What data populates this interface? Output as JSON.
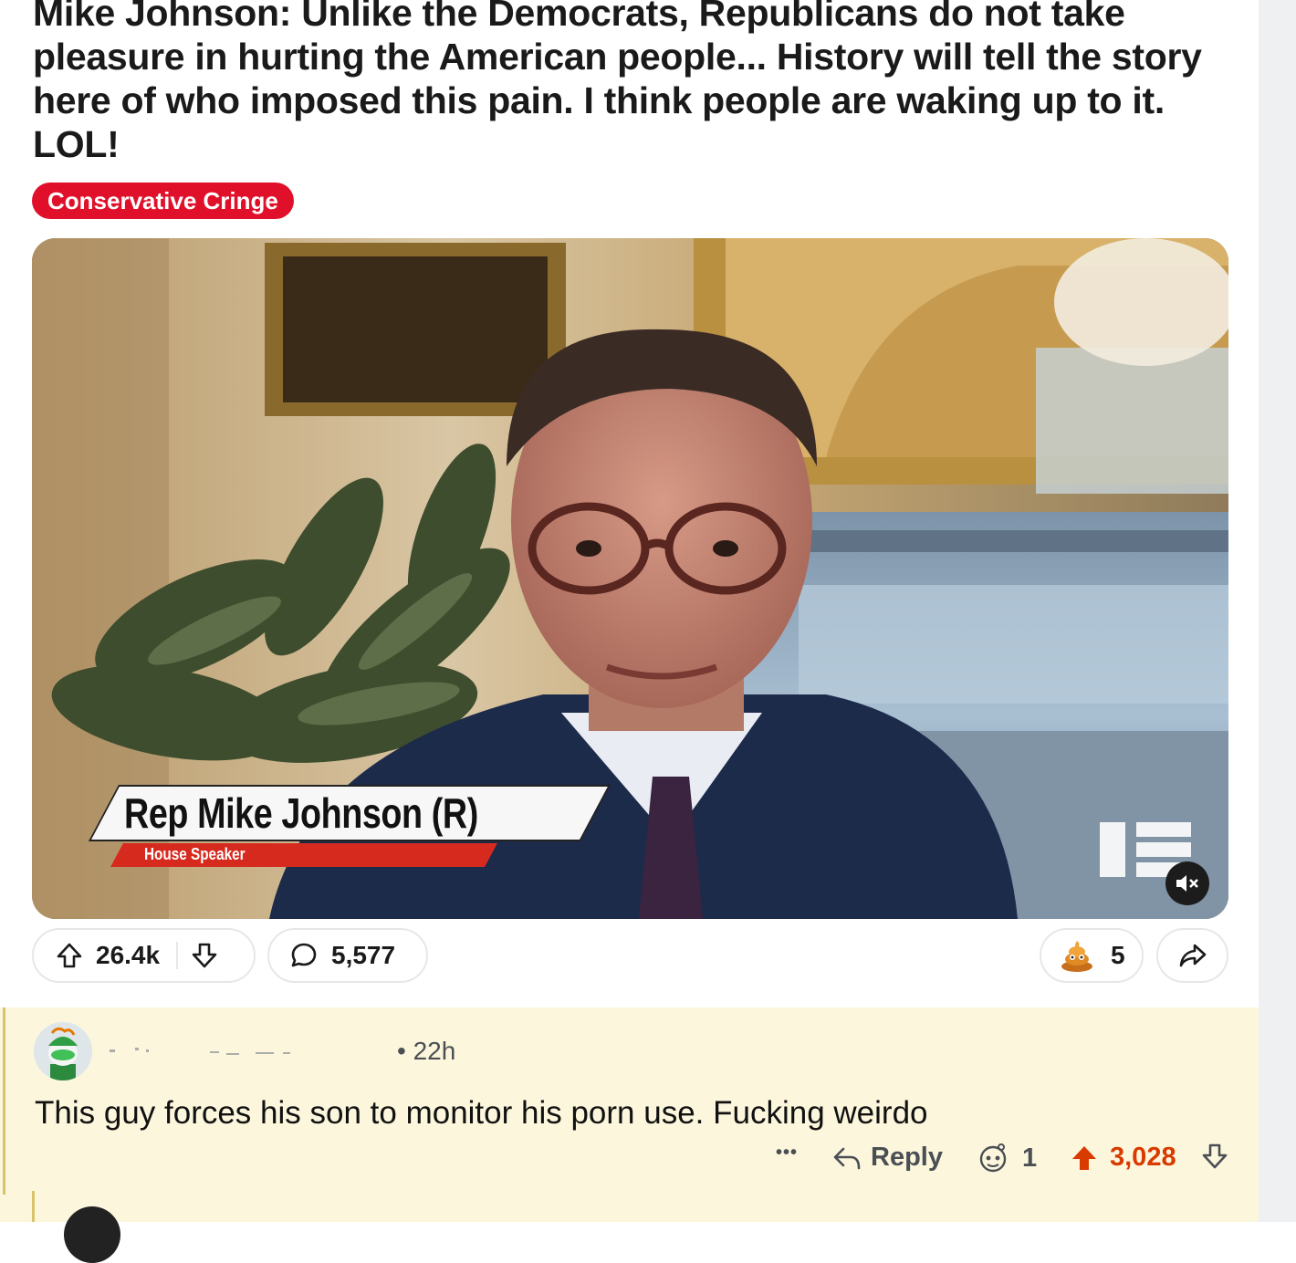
{
  "post": {
    "title": "Mike Johnson: Unlike the Democrats, Republicans do not take pleasure in hurting the American people... History will tell the story here of who imposed this pain. I think people are waking up to it. LOL!",
    "flair": "Conservative Cringe",
    "flair_color": "#e0102b",
    "video": {
      "lower_third_name": "Rep Mike Johnson (R)",
      "lower_third_role": "House Speaker",
      "mute_icon": "speaker-muted-icon"
    },
    "upvotes": "26.4k",
    "comments": "5,577",
    "awards": "5",
    "award_icon": "poop-award-icon"
  },
  "comment": {
    "time": "• 22h",
    "body": "This guy forces his son to monitor his porn use.  Fucking weirdo",
    "more_label": "•••",
    "reply_label": "Reply",
    "award_count": "1",
    "score": "3,028",
    "score_color": "#d93a00"
  }
}
